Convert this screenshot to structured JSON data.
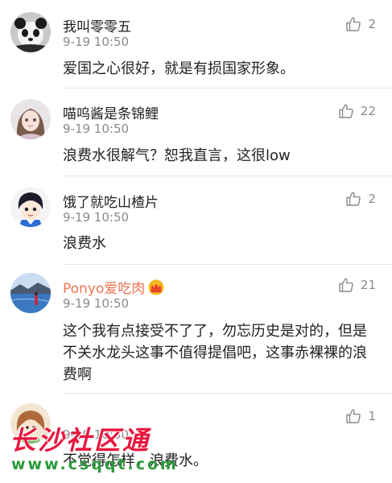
{
  "comments": [
    {
      "name": "我叫零零五",
      "time": "9-19 10:50",
      "likes": "2",
      "text": "爱国之心很好，就是有损国家形象。",
      "avatar": "panda-avatar"
    },
    {
      "name": "喵呜酱是条锦鲤",
      "time": "9-19 10:50",
      "likes": "22",
      "text": "浪费水很解气？恕我直言，这很low",
      "avatar": "doll-avatar"
    },
    {
      "name": "饿了就吃山楂片",
      "time": "9-19 10:50",
      "likes": "2",
      "text": "浪费水",
      "avatar": "cartoon-boy-avatar"
    },
    {
      "name": "Ponyo爱吃肉",
      "time": "9-19 10:50",
      "likes": "21",
      "text": "这个我有点接受不了了，勿忘历史是对的，但是不关水龙头这事不值得提倡吧，这事赤裸裸的浪费啊",
      "avatar": "lake-avatar",
      "vip_badge": "crown-icon"
    },
    {
      "name": "",
      "time": "9-19 10:50",
      "likes": "1",
      "text": "不觉得怎样，浪费水。",
      "avatar": "cartoon-girl-avatar"
    }
  ],
  "watermark": {
    "title": "长沙社区通",
    "url": "www.csqqt.com"
  },
  "colors": {
    "vip_name": "#eb7350",
    "meta": "#8a8a8a",
    "watermark_red": "#e8173f",
    "watermark_green": "#2a9a3a"
  }
}
